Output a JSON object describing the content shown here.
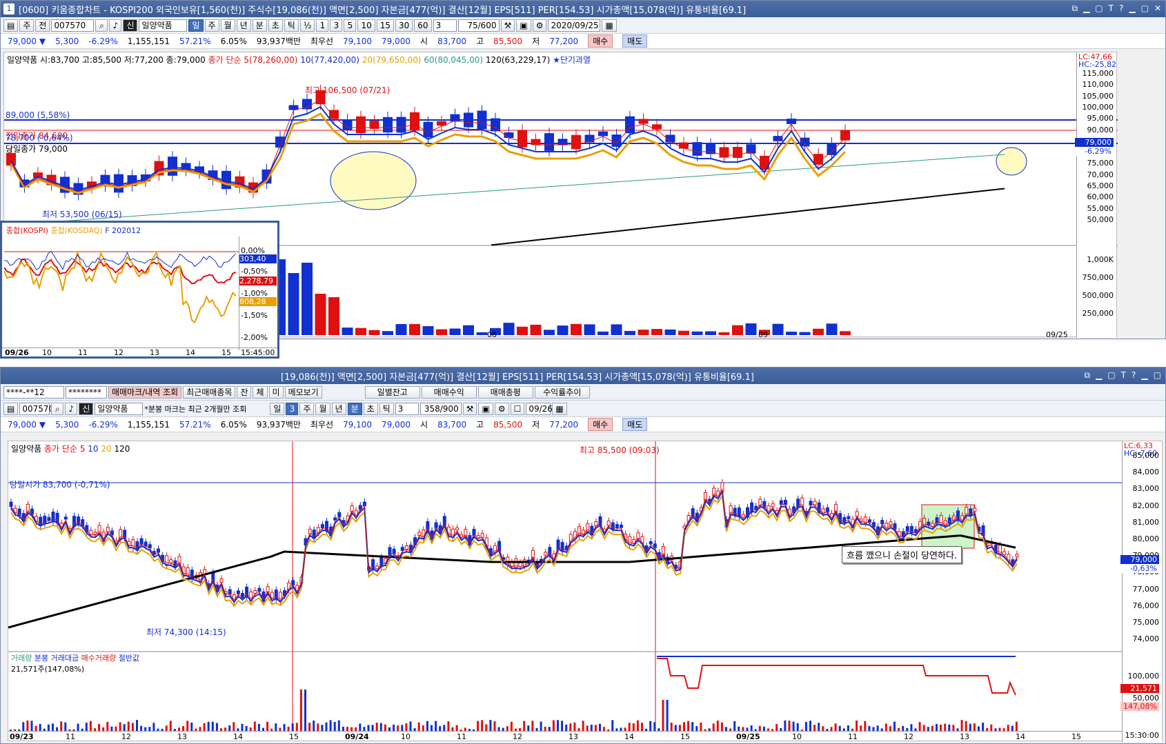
{
  "top": {
    "title": "[0600] 키움종합차트 - KOSPI200 외국인보유[1,560(천)] 주식수[19,086(천)] 액면[2,500] 자본금[477(억)] 결산[12월] EPS[511] PER[154.53] 시가총액[15,078(억)] 유통비율[69.1]",
    "window_num": "1",
    "toolbar": {
      "period_labels": [
        "주",
        "전"
      ],
      "code": "007570",
      "name": "일양약품",
      "name_tag": "신",
      "tabs": [
        "일",
        "주",
        "월",
        "년",
        "분",
        "초",
        "틱"
      ],
      "frac": "½",
      "intervals": [
        "1",
        "3",
        "5",
        "10",
        "15",
        "30",
        "60"
      ],
      "interval_sel": "3",
      "count": "75/600",
      "date": "2020/09/25"
    },
    "quote": {
      "price": "79,000",
      "arrow": "▼",
      "change": "5,300",
      "pct": "-6.29%",
      "volume": "1,155,151",
      "ratio1": "57.21%",
      "ratio2": "6.05%",
      "amount": "93,937백만",
      "pref_label": "최우선",
      "pref1": "79,100",
      "pref2": "79,000",
      "open_label": "시",
      "open": "83,700",
      "high_label": "고",
      "high": "85,500",
      "low_label": "저",
      "low": "77,200",
      "sell": "매수",
      "buy": "매도"
    },
    "legend": {
      "name": "일양약품",
      "ohlc": "시:83,700 고:85,500 저:77,200 종:79,000",
      "ma_title": "종가 단순",
      "ma5": "5(78,260,00)",
      "ma10": "10(77,420,00)",
      "ma20": "20(79,650,00)",
      "ma60": "60(80,045,00)",
      "ma120": "120(63,229,17)",
      "signal": "★단기과열"
    },
    "annotations": {
      "high": "최고 106,500 (07/21)",
      "low": "최저 53,500 (06/15)",
      "line1": "89,000 (5,58%)",
      "line2": "전일종가 84,600",
      "line3": "78,700 (-0,64%)",
      "line4": "당일종가 79,000"
    },
    "lc": "LC:47,66",
    "hc": "HC:-25,82",
    "price_axis": [
      "115,000",
      "110,000",
      "105,000",
      "100,000",
      "95,000",
      "90,000",
      "85,000",
      "80,000",
      "75,000",
      "70,000",
      "65,000",
      "60,000",
      "55,000",
      "50,000"
    ],
    "current_tag": "79,000",
    "current_pct": "-6,29%",
    "vol_axis": [
      "1,000K",
      "750,000",
      "500,000",
      "250,000"
    ],
    "date_axis": [
      "08",
      "09",
      "09/25"
    ]
  },
  "inset": {
    "legend": [
      "종합(KOSPI)",
      "종합(KOSDAQ)",
      "F 202012"
    ],
    "y_axis": [
      "0,00%",
      "-0,50%",
      "-1,00%",
      "-1,50%",
      "-2,00%"
    ],
    "tags": {
      "f": "303,40",
      "kospi": "2,278,79",
      "kosdaq": "808,28"
    },
    "x_axis": [
      "09/26",
      "10",
      "11",
      "12",
      "13",
      "14",
      "15"
    ],
    "time": "15:45:00"
  },
  "bottom": {
    "title": "[19,086(천)] 액면[2,500] 자본금[477(억)] 결산[12월] EPS[511] PER[154.53] 시가총액[15,078(억)] 유통비율[69.1]",
    "row1": {
      "acct": "****-**12",
      "pw": "********",
      "b1": "매매마크/내역 조회",
      "b2": "최근매매종목",
      "b3": "잔",
      "b4": "체",
      "b5": "미",
      "b6": "메모보기",
      "b7": "일별잔고",
      "b8": "매매수익",
      "b9": "매매총평",
      "b10": "수익률추이"
    },
    "toolbar": {
      "code": "007570",
      "name": "일양약품",
      "name_tag": "신",
      "note": "*분봉 마크는 최근 2개월만 조회",
      "tabs": [
        "일",
        "3",
        "주",
        "월",
        "년",
        "분",
        "초",
        "틱"
      ],
      "interval": "3",
      "count": "358/900",
      "date": "09/26"
    },
    "quote": {
      "price": "79,000",
      "arrow": "▼",
      "change": "5,300",
      "pct": "-6.29%",
      "volume": "1,155,151",
      "ratio1": "57.21%",
      "ratio2": "6.05%",
      "amount": "93,937백만",
      "pref_label": "최우선",
      "pref1": "79,100",
      "pref2": "79,000",
      "open_label": "시",
      "open": "83,700",
      "high_label": "고",
      "high": "85,500",
      "low_label": "저",
      "low": "77,200",
      "sell": "매수",
      "buy": "매도"
    },
    "legend": {
      "name": "일양약품",
      "ma_title": "종가 단순",
      "ma5": "5",
      "ma10": "10",
      "ma20": "20",
      "ma120": "120"
    },
    "annotations": {
      "open": "당일시가 83,700 (-0,71%)",
      "high": "최고 85,500 (09:03)",
      "low": "최저 74,300 (14:15)",
      "note": "흐름 깼으니 손절이 당연하다."
    },
    "lc": "LC:6,33",
    "hc": "HC:-7,60",
    "price_axis": [
      "85,000",
      "84,000",
      "83,000",
      "82,000",
      "81,000",
      "80,000",
      "79,000",
      "78,000",
      "77,000",
      "76,000",
      "75,000",
      "74,000"
    ],
    "current_tag": "79,000",
    "current_pct": "-0,63%",
    "vol_legend": {
      "a": "거래량",
      "b": "분봉 거래대금",
      "c": "매수거래량",
      "d": "절반값",
      "val": "21,571주(147,08%)"
    },
    "vol_axis": [
      "100,000",
      "50,000"
    ],
    "vol_tag": "21,571",
    "vol_pct": "147,08%",
    "date_axis": [
      "09/23",
      "11",
      "12",
      "13",
      "14",
      "15",
      "09/24",
      "10",
      "11",
      "12",
      "13",
      "14",
      "15",
      "09/25",
      "10",
      "11",
      "12",
      "13",
      "14",
      "15"
    ],
    "time": "15:30:00"
  },
  "colors": {
    "up": "#e01010",
    "down": "#1030d0",
    "ma5": "#e01010",
    "ma10": "#1030d0",
    "ma20": "#e8a000",
    "ma60": "#2a9a80",
    "ma120": "#000000",
    "title": "#3b5c98"
  }
}
